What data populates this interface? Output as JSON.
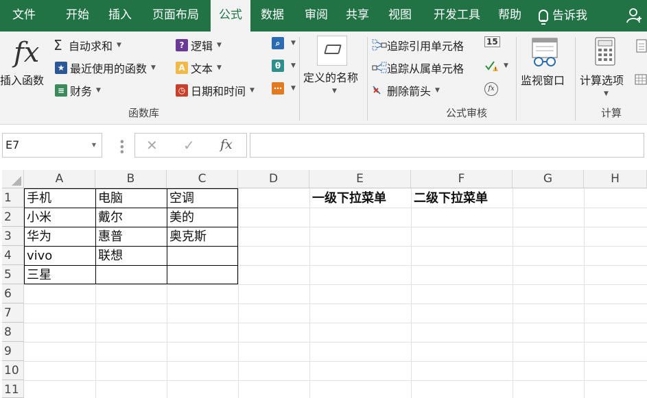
{
  "menu": {
    "tabs": [
      "文件",
      "开始",
      "插入",
      "页面布局",
      "公式",
      "数据",
      "审阅",
      "共享",
      "视图",
      "开发工具",
      "帮助",
      "告诉我"
    ],
    "active": "公式"
  },
  "ribbon": {
    "function_library": {
      "insert_function": "插入函数",
      "fx": "fx",
      "autosum": "自动求和",
      "recent": "最近使用的函数",
      "financial": "财务",
      "logical": "逻辑",
      "text": "文本",
      "datetime": "日期和时间",
      "group_label": "函数库"
    },
    "defined_names": {
      "label": "定义的名称"
    },
    "formula_auditing": {
      "trace_precedents": "追踪引用单元格",
      "trace_dependents": "追踪从属单元格",
      "remove_arrows": "删除箭头",
      "group_label": "公式审核",
      "watch_window": "监视窗口"
    },
    "calculation": {
      "options": "计算选项",
      "group_label": "计算"
    }
  },
  "formula_bar": {
    "name_box": "E7",
    "fx": "fx",
    "formula": ""
  },
  "sheet": {
    "columns": [
      "A",
      "B",
      "C",
      "D",
      "E",
      "F",
      "G",
      "H"
    ],
    "rows": [
      "1",
      "2",
      "3",
      "4",
      "5",
      "6",
      "7",
      "8",
      "9",
      "10",
      "11"
    ],
    "cells": {
      "A1": "手机",
      "B1": "电脑",
      "C1": "空调",
      "A2": "小米",
      "B2": "戴尔",
      "C2": "美的",
      "A3": "华为",
      "B3": "惠普",
      "C3": "奥克斯",
      "A4": "vivo",
      "B4": "联想",
      "A5": "三星",
      "E1": "一级下拉菜单",
      "F1": "二级下拉菜单"
    },
    "selected_cell": "E7"
  },
  "colors": {
    "accent": "#217346",
    "ribbon_bg": "#f3f3f3"
  }
}
